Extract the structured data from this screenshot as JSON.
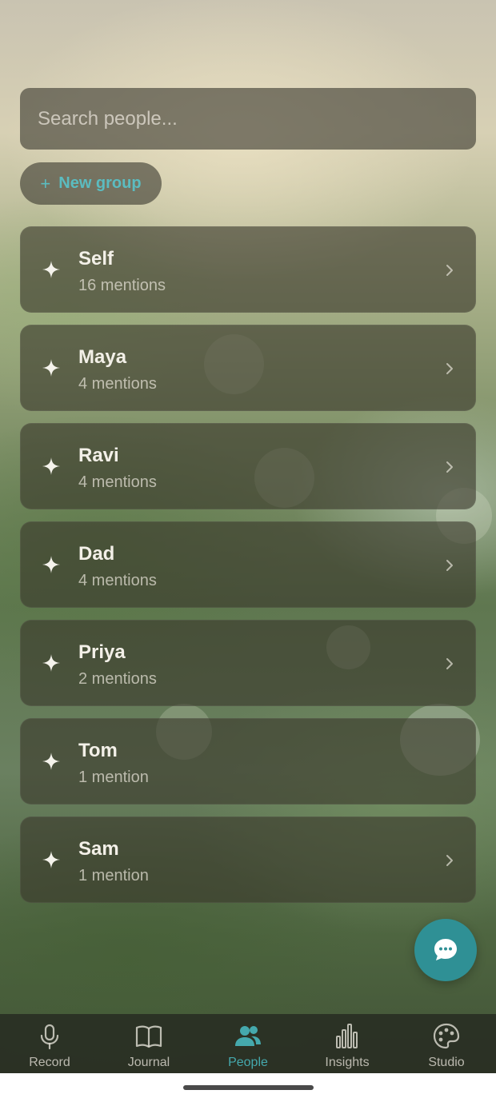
{
  "search": {
    "placeholder": "Search people..."
  },
  "new_group": {
    "label": "New group"
  },
  "people": [
    {
      "name": "Self",
      "mentions": "16 mentions"
    },
    {
      "name": "Maya",
      "mentions": "4 mentions"
    },
    {
      "name": "Ravi",
      "mentions": "4 mentions"
    },
    {
      "name": "Dad",
      "mentions": "4 mentions"
    },
    {
      "name": "Priya",
      "mentions": "2 mentions"
    },
    {
      "name": "Tom",
      "mentions": "1 mention"
    },
    {
      "name": "Sam",
      "mentions": "1 mention"
    }
  ],
  "tabs": [
    {
      "label": "Record",
      "icon": "microphone-icon"
    },
    {
      "label": "Journal",
      "icon": "book-icon"
    },
    {
      "label": "People",
      "icon": "people-icon",
      "active": true
    },
    {
      "label": "Insights",
      "icon": "bar-chart-icon"
    },
    {
      "label": "Studio",
      "icon": "palette-icon"
    }
  ],
  "colors": {
    "accent": "#45a9ad",
    "fab": "#2f9095"
  }
}
